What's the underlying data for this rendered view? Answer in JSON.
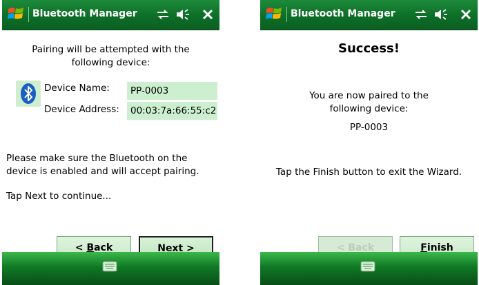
{
  "app": {
    "title": "Bluetooth Manager"
  },
  "screen_a": {
    "intro": "Pairing will be attempted with the following device:",
    "device_name_label": "Device Name:",
    "device_name_value": "PP-0003",
    "device_address_label": "Device Address:",
    "device_address_value": "00:03:7a:66:55:c2",
    "note": "Please make sure the Bluetooth on the device is enabled and will accept pairing.",
    "tap_next": "Tap Next to continue...",
    "back_button": {
      "prefix": "< ",
      "mnemonic": "B",
      "rest": "ack"
    },
    "next_button": {
      "mnemonic": "N",
      "rest": "ext >"
    }
  },
  "screen_b": {
    "heading": "Success!",
    "paired_text": "You are now paired to the following device:",
    "device_name": "PP-0003",
    "instruction": "Tap the Finish button to exit the Wizard.",
    "back_button": {
      "label": "< Back"
    },
    "finish_button": {
      "mnemonic": "F",
      "rest": "inish"
    }
  },
  "icons": {
    "start": "windows-logo-icon",
    "connectivity": "connectivity-icon",
    "volume": "volume-icon",
    "close": "close-icon",
    "bluetooth": "bluetooth-icon",
    "keyboard": "keyboard-icon"
  },
  "colors": {
    "titlebar": "#0d6e27",
    "field_bg": "#ccefd0",
    "button_bg": "#c9e9c9"
  }
}
